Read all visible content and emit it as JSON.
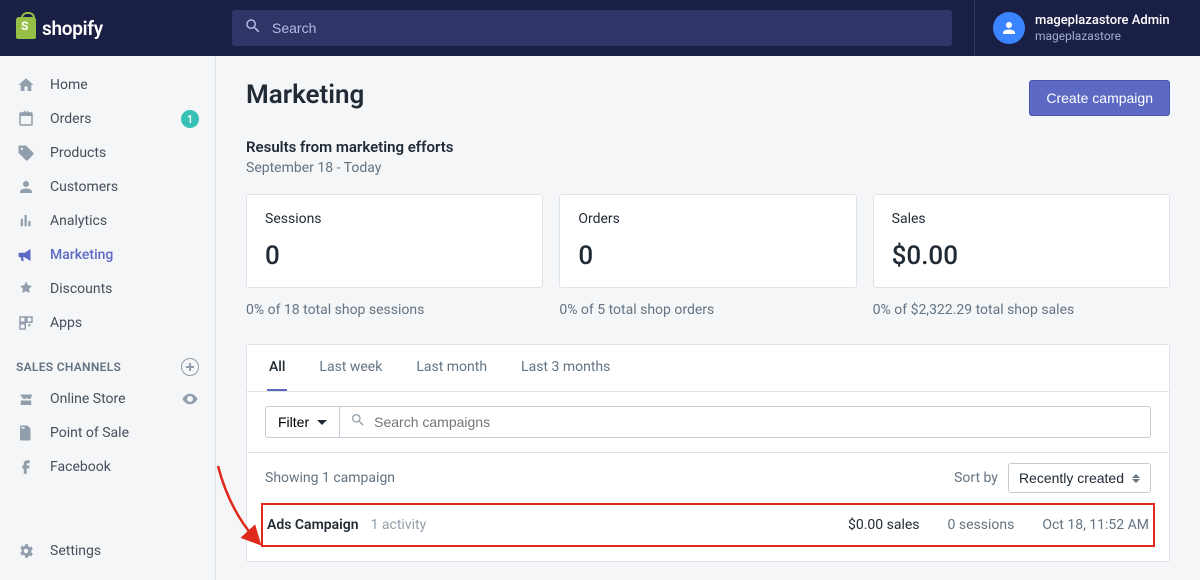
{
  "brand": {
    "name": "shopify"
  },
  "search": {
    "placeholder": "Search"
  },
  "user": {
    "name": "mageplazastore Admin",
    "store": "mageplazastore"
  },
  "sidebar": {
    "items": [
      {
        "label": "Home"
      },
      {
        "label": "Orders",
        "badge": "1"
      },
      {
        "label": "Products"
      },
      {
        "label": "Customers"
      },
      {
        "label": "Analytics"
      },
      {
        "label": "Marketing"
      },
      {
        "label": "Discounts"
      },
      {
        "label": "Apps"
      }
    ],
    "section": "SALES CHANNELS",
    "channels": [
      {
        "label": "Online Store"
      },
      {
        "label": "Point of Sale"
      },
      {
        "label": "Facebook"
      }
    ],
    "settings": "Settings"
  },
  "page": {
    "title": "Marketing",
    "cta": "Create campaign",
    "subhead": "Results from marketing efforts",
    "range": "September 18 - Today"
  },
  "stats": {
    "sessions": {
      "label": "Sessions",
      "value": "0",
      "foot": "0% of 18 total shop sessions"
    },
    "orders": {
      "label": "Orders",
      "value": "0",
      "foot": "0% of 5 total shop orders"
    },
    "sales": {
      "label": "Sales",
      "value": "$0.00",
      "foot": "0% of $2,322.29 total shop sales"
    }
  },
  "tabs": [
    "All",
    "Last week",
    "Last month",
    "Last 3 months"
  ],
  "filter": {
    "label": "Filter",
    "search_placeholder": "Search campaigns"
  },
  "list": {
    "showing": "Showing 1 campaign",
    "sort_label": "Sort by",
    "sort_selected": "Recently created",
    "rows": [
      {
        "name": "Ads Campaign",
        "activity": "1 activity",
        "sales": "$0.00 sales",
        "sessions": "0 sessions",
        "date": "Oct 18, 11:52 AM"
      }
    ]
  }
}
